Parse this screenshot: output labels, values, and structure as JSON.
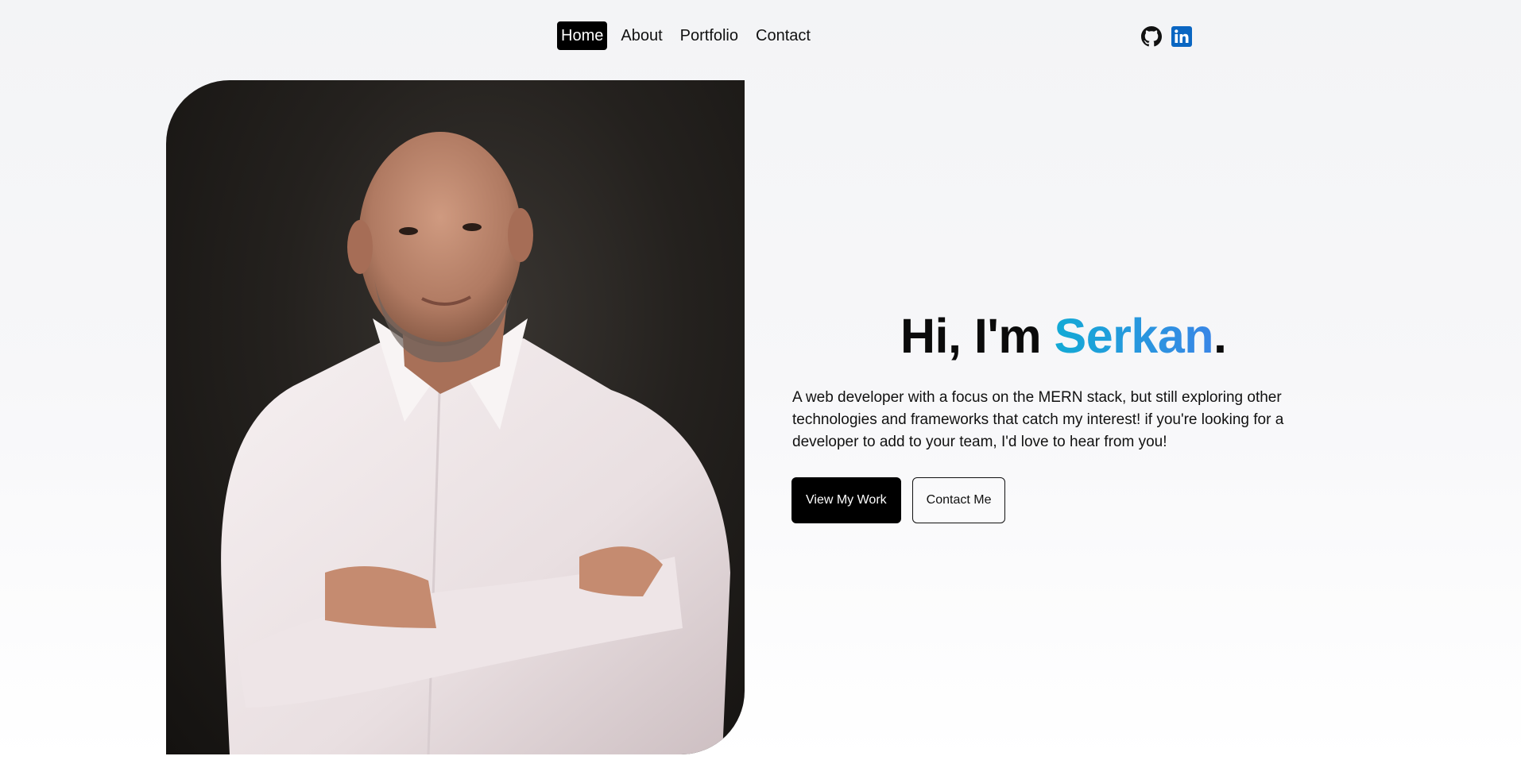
{
  "nav": {
    "items": [
      {
        "label": "Home",
        "active": true
      },
      {
        "label": "About",
        "active": false
      },
      {
        "label": "Portfolio",
        "active": false
      },
      {
        "label": "Contact",
        "active": false
      }
    ]
  },
  "social": {
    "github_icon": "github-icon",
    "linkedin_icon": "linkedin-icon",
    "linkedin_color": "#0a66c2"
  },
  "hero": {
    "greeting": "Hi, I'm ",
    "name": "Serkan",
    "punct": ".",
    "name_gradient": [
      "#13aad5",
      "#3a86e6"
    ],
    "bio": "A web developer with a focus on the MERN stack, but still exploring other technologies and frameworks that catch my interest! if you're looking for a developer to add to your team, I'd love to hear from you!",
    "primary_button": "View My Work",
    "secondary_button": "Contact Me"
  }
}
